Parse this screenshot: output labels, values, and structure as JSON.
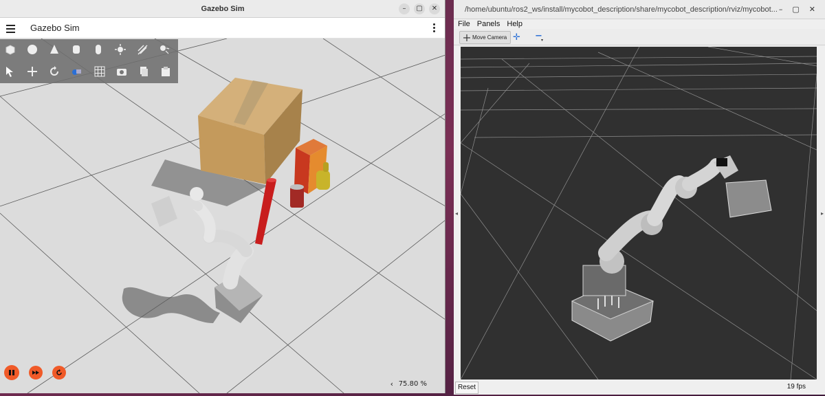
{
  "gazebo": {
    "window_title": "Gazebo Sim",
    "app_title": "Gazebo Sim",
    "window_buttons": [
      "–",
      "▢",
      "✕"
    ],
    "shape_tools": [
      "box-icon",
      "sphere-icon",
      "cone-icon",
      "cylinder-icon",
      "capsule-icon",
      "sun-icon",
      "directional-light-icon",
      "spot-light-icon"
    ],
    "transform_tools": [
      "select-icon",
      "translate-icon",
      "rotate-icon",
      "view-angle-icon",
      "grid-icon",
      "screenshot-icon",
      "copy-icon",
      "paste-icon"
    ],
    "real_time_factor": "75.80 %",
    "rtf_chevron": "‹",
    "colors": {
      "accent": "#f05a28",
      "ground": "#dcdcdc",
      "box": "#c9a46b",
      "cylinder": "#c81d1d"
    }
  },
  "rviz": {
    "window_title": "/home/ubuntu/ros2_ws/install/mycobot_description/share/mycobot_description/rviz/mycobot...",
    "window_buttons": [
      "–",
      "▢",
      "✕"
    ],
    "menu": [
      "File",
      "Panels",
      "Help"
    ],
    "move_camera_label": "Move Camera",
    "reset_label": "Reset",
    "fps": "19 fps",
    "colors": {
      "viewport": "#303030",
      "grid": "#9a9a9a"
    }
  }
}
